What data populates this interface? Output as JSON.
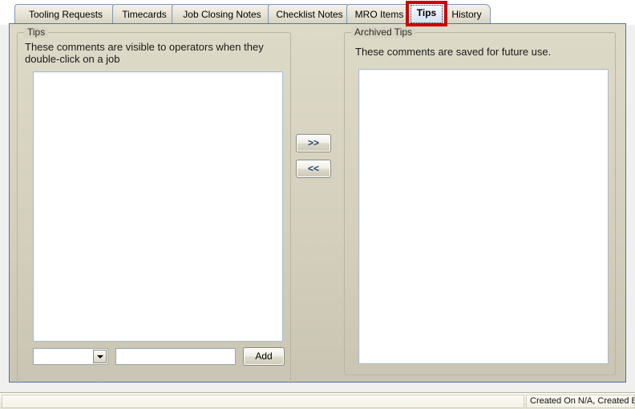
{
  "window": {
    "background_color": "#d3cfbc",
    "panel_border_color": "#4f74a8"
  },
  "tabs": {
    "items": [
      {
        "label": "Tooling Requests",
        "active": false
      },
      {
        "label": "Timecards",
        "active": false
      },
      {
        "label": "Job Closing Notes",
        "active": false
      },
      {
        "label": "Checklist Notes",
        "active": false
      },
      {
        "label": "MRO Items",
        "active": false
      },
      {
        "label": "Tips",
        "active": true
      },
      {
        "label": "History",
        "active": false
      }
    ],
    "selected_label": "Tips",
    "highlight_color": "#cc0000"
  },
  "tips_group": {
    "title": "Tips",
    "description": "These comments are visible to operators when they double-click on a job",
    "list_items": []
  },
  "archived_group": {
    "title": "Archived Tips",
    "description": "These comments are saved for future use.",
    "list_items": []
  },
  "transfer": {
    "move_right_label": ">>",
    "move_left_label": "<<"
  },
  "entry_row": {
    "dropdown_value": "",
    "dropdown_arrow_icon": "chevron-down-icon",
    "text_value": "",
    "text_placeholder": "",
    "add_label": "Add"
  },
  "statusbar": {
    "left_text": "",
    "right_text": "Created On N/A, Created B"
  }
}
